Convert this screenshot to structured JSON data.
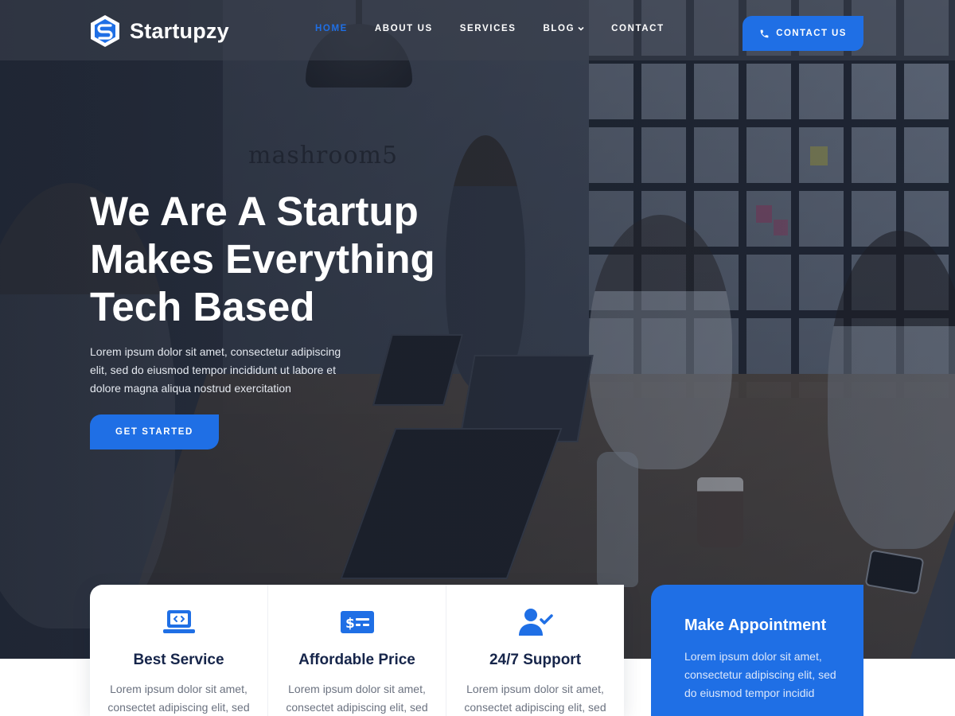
{
  "brand": {
    "name": "Startupzy",
    "accent": "#1f6fe5"
  },
  "nav": {
    "items": [
      {
        "label": "HOME",
        "active": true
      },
      {
        "label": "ABOUT US",
        "active": false
      },
      {
        "label": "SERVICES",
        "active": false
      },
      {
        "label": "BLOG",
        "active": false,
        "has_dropdown": true
      },
      {
        "label": "CONTACT",
        "active": false
      }
    ],
    "cta": {
      "label": "CONTACT US",
      "icon": "phone-icon"
    }
  },
  "hero": {
    "background_sign": "mashroom5",
    "title_lines": [
      "We Are A Startup",
      "Makes Everything",
      "Tech Based"
    ],
    "description": "Lorem ipsum dolor sit amet, consectetur adipiscing elit, sed do eiusmod tempor incididunt ut labore et dolore magna aliqua nostrud exercitation",
    "button": "GET STARTED"
  },
  "features": [
    {
      "icon": "laptop-code-icon",
      "title": "Best Service",
      "text": "Lorem ipsum dolor sit amet, consectet adipiscing elit, sed"
    },
    {
      "icon": "price-card-icon",
      "title": "Affordable Price",
      "text": "Lorem ipsum dolor sit amet, consectet adipiscing elit, sed"
    },
    {
      "icon": "user-check-icon",
      "title": "24/7 Support",
      "text": "Lorem ipsum dolor sit amet, consectet adipiscing elit, sed"
    }
  ],
  "appointment": {
    "title": "Make Appointment",
    "text": "Lorem ipsum dolor sit amet, consectetur adipiscing elit, sed do eiusmod tempor incidid"
  }
}
